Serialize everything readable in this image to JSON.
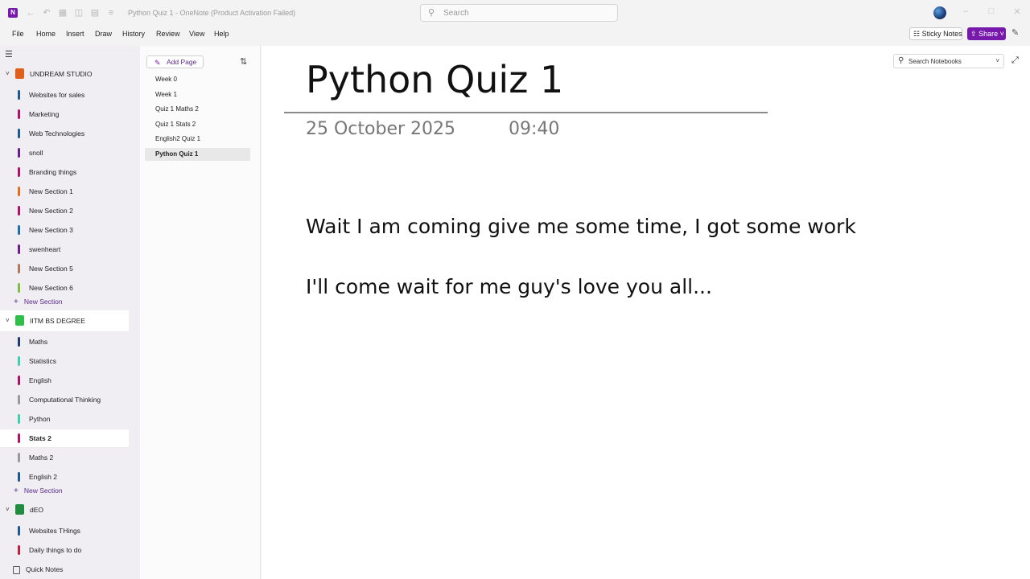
{
  "window": {
    "title": "Python Quiz 1 - OneNote (Product Activation Failed)",
    "search_placeholder": "Search",
    "app_icon_letter": "N"
  },
  "menu": [
    "File",
    "Home",
    "Insert",
    "Draw",
    "History",
    "Review",
    "View",
    "Help"
  ],
  "toolbar": {
    "sticky_notes": "Sticky Notes",
    "share": "Share"
  },
  "notebooks": [
    {
      "name": "UNDREAM STUDIO",
      "color": "#e0601b",
      "sections": [
        {
          "name": "Websites for sales",
          "color": "#1e5a8e"
        },
        {
          "name": "Marketing",
          "color": "#b0126b"
        },
        {
          "name": "Web Technologies",
          "color": "#1e5a8e"
        },
        {
          "name": "snoll",
          "color": "#6b1e8e"
        },
        {
          "name": "Branding things",
          "color": "#b0126b"
        },
        {
          "name": "New Section 1",
          "color": "#e07020"
        },
        {
          "name": "New Section 2",
          "color": "#b0126b"
        },
        {
          "name": "New Section 3",
          "color": "#1e6ea8"
        },
        {
          "name": "swenheart",
          "color": "#6b1e8e"
        },
        {
          "name": "New Section 5",
          "color": "#b07a5a"
        },
        {
          "name": "New Section 6",
          "color": "#7ac043"
        }
      ],
      "new_section": "New Section"
    },
    {
      "name": "IITM BS DEGREE",
      "color": "#2ec04a",
      "sections": [
        {
          "name": "Maths",
          "color": "#1e3f6e"
        },
        {
          "name": "Statistics",
          "color": "#3fd0b0"
        },
        {
          "name": "English",
          "color": "#b0126b"
        },
        {
          "name": "Computational Thinking",
          "color": "#9a9a9a"
        },
        {
          "name": "Python",
          "color": "#3fd0b0"
        },
        {
          "name": "Stats 2",
          "color": "#b0126b"
        },
        {
          "name": "Maths 2",
          "color": "#9a9a9a"
        },
        {
          "name": "English 2",
          "color": "#1e5a8e"
        }
      ],
      "new_section": "New Section"
    },
    {
      "name": "dEO",
      "color": "#1e8e3e",
      "sections": [
        {
          "name": "Websites THings",
          "color": "#1e5a8e"
        },
        {
          "name": "Daily things to do",
          "color": "#c01e3a"
        }
      ]
    }
  ],
  "quick_notes": "Quick Notes",
  "pages_pane": {
    "add_page": "Add Page",
    "pages": [
      "Week 0",
      "Week 1",
      "Quiz 1 Maths 2",
      "Quiz 1 Stats 2",
      "English2  Quiz 1",
      "Python Quiz 1"
    ]
  },
  "note": {
    "title": "Python Quiz 1",
    "date": "25 October 2025",
    "time": "09:40",
    "lines": [
      "Wait I am coming give me some time, I got some work",
      "I'll come wait for me guy's love you all..."
    ],
    "search_notebooks": "Search Notebooks"
  }
}
